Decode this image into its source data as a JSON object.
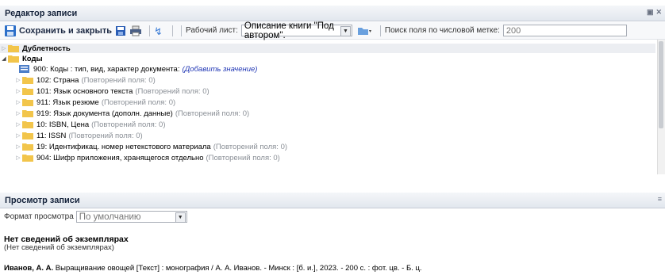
{
  "editor": {
    "title": "Редактор записи",
    "save_label": "Сохранить и закрыть",
    "worksheet_label": "Рабочий лист:",
    "worksheet_value": "Описание книги \"Под автором\".",
    "search_label": "Поиск поля по числовой метке:",
    "search_value": "200"
  },
  "tree": {
    "dup_label": "Дублетность",
    "codes_label": "Коды",
    "field_900": "900: Коды : тип, вид, характер документа:",
    "add_value": "(Добавить значение)",
    "items": [
      {
        "label": "102: Страна",
        "count": "(Повторений поля: 0)"
      },
      {
        "label": "101: Язык основного текста",
        "count": "(Повторений поля: 0)"
      },
      {
        "label": "911: Язык резюме",
        "count": "(Повторений поля: 0)"
      },
      {
        "label": "919: Язык документа (дополн. данные)",
        "count": "(Повторений поля: 0)"
      },
      {
        "label": "10: ISBN, Цена",
        "count": "(Повторений поля: 0)"
      },
      {
        "label": "11: ISSN",
        "count": "(Повторений поля: 0)"
      },
      {
        "label": "19: Идентификац. номер нетекстового материала",
        "count": "(Повторений поля: 0)"
      },
      {
        "label": "904: Шифр приложения, хранящегося отдельно",
        "count": "(Повторений поля: 0)"
      }
    ]
  },
  "viewer": {
    "title": "Просмотр записи",
    "format_label": "Формат просмотра",
    "format_value": "По умолчанию",
    "no_copies_title": "Нет сведений об экземплярах",
    "no_copies_sub": "(Нет сведений об экземплярах)",
    "author": "Иванов, А. А.",
    "record_text": "Выращивание овощей [Текст] : монография / А. А. Иванов. - Минск : [б. и.], 2023. - 200 с. : фот. цв. - Б. ц."
  },
  "colors": {
    "folder": "#f2c54b",
    "header_text": "#15233b",
    "link": "#2137b5"
  }
}
